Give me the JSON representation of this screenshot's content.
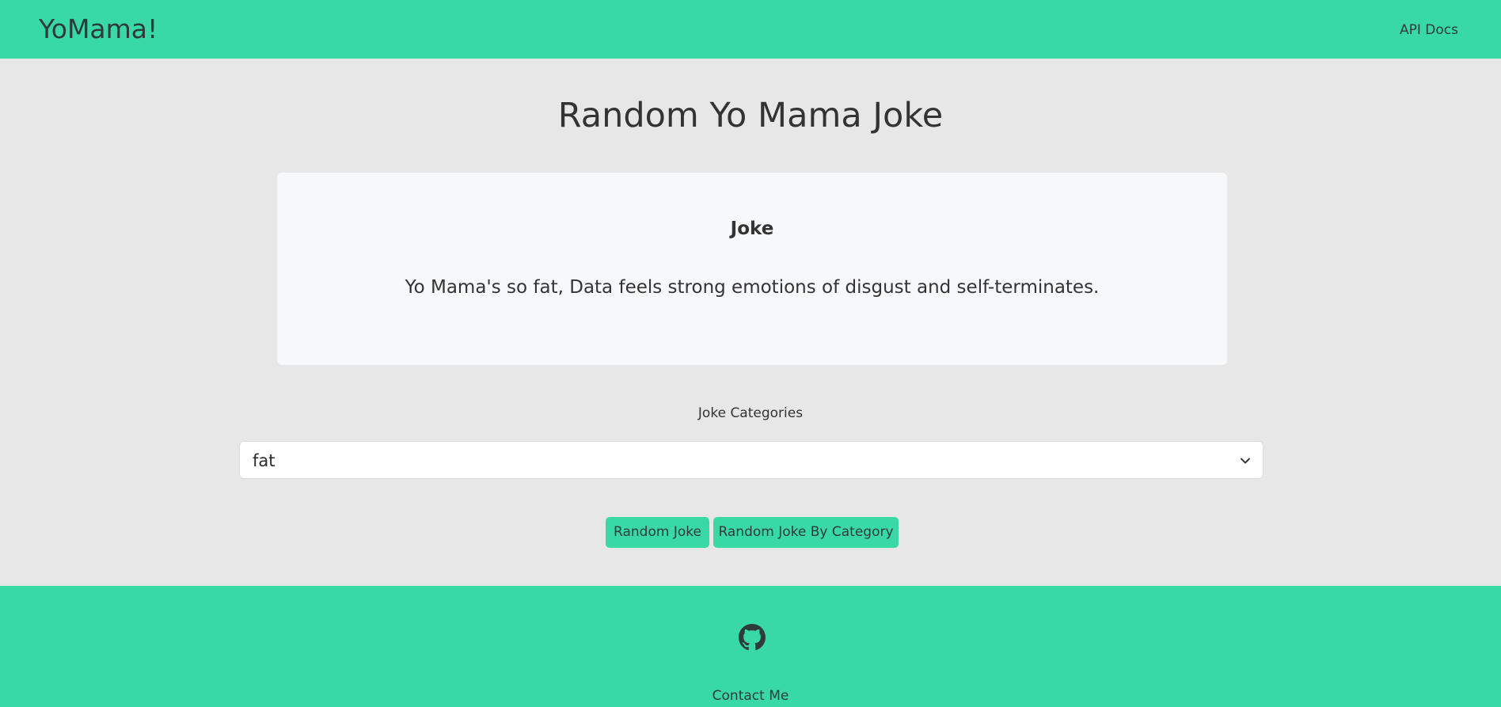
{
  "navbar": {
    "brand": "YoMama!",
    "link_api_docs": "API Docs",
    "color": "#39d9a6"
  },
  "main": {
    "title": "Random Yo Mama Joke",
    "card": {
      "heading": "Joke",
      "text": "Yo Mama's so fat, Data feels strong emotions of disgust and self-terminates."
    },
    "category_label": "Joke Categories",
    "category_select": {
      "selected": "fat",
      "icon": "chevron-down-icon"
    },
    "buttons": {
      "random": "Random Joke",
      "random_by_category": "Random Joke By Category"
    }
  },
  "footer": {
    "icon": "github-icon",
    "contact": "Contact Me"
  }
}
